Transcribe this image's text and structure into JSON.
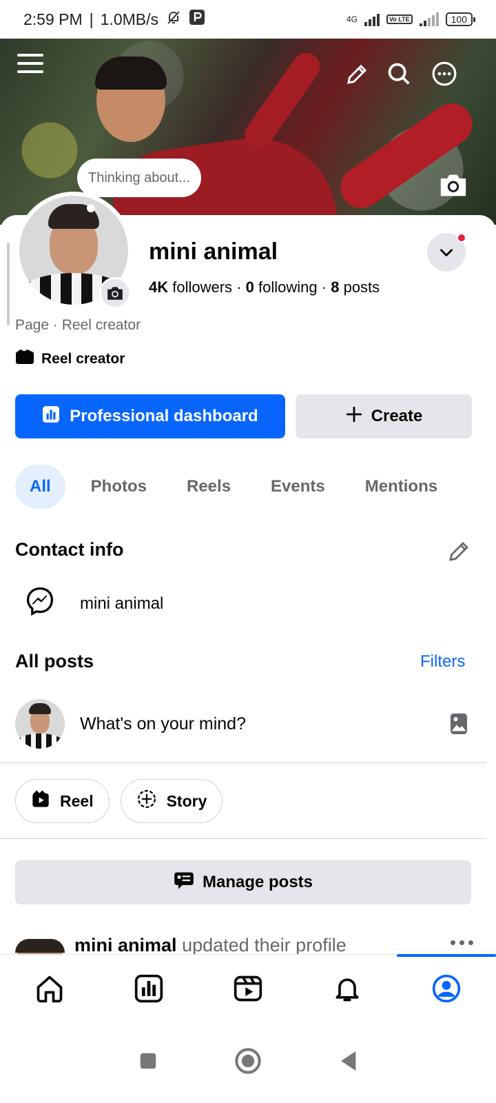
{
  "status_bar": {
    "time": "2:59 PM",
    "separator": "|",
    "speed": "1.0MB/s",
    "network_label": "4G",
    "volte_label": "Vo LTE",
    "battery": "100"
  },
  "cover": {
    "thought_bubble": "Thinking about..."
  },
  "profile": {
    "name": "mini animal",
    "followers_count": "4K",
    "followers_label": "followers",
    "following_count": "0",
    "following_label": "following",
    "posts_count": "8",
    "posts_label": "posts",
    "dot": "·",
    "category": "Page · Reel creator",
    "badge_label": "Reel creator"
  },
  "actions": {
    "dashboard_label": "Professional dashboard",
    "create_label": "Create"
  },
  "tabs": [
    {
      "label": "All",
      "active": true
    },
    {
      "label": "Photos",
      "active": false
    },
    {
      "label": "Reels",
      "active": false
    },
    {
      "label": "Events",
      "active": false
    },
    {
      "label": "Mentions",
      "active": false
    }
  ],
  "contact": {
    "title": "Contact info",
    "messenger_name": "mini animal"
  },
  "posts": {
    "title": "All posts",
    "filters_label": "Filters",
    "composer_placeholder": "What's on your mind?",
    "reel_chip": "Reel",
    "story_chip": "Story",
    "manage_label": "Manage posts",
    "feed_author": "mini animal",
    "feed_action": "updated their profile"
  },
  "colors": {
    "accent": "#0866ff",
    "secondary_bg": "#e4e6eb",
    "notification_dot": "#e41e3f"
  },
  "icons": [
    "menu-icon",
    "pencil-icon",
    "search-icon",
    "more-icon",
    "camera-icon",
    "chevron-down-icon",
    "clapperboard-icon",
    "dashboard-icon",
    "plus-icon",
    "messenger-icon",
    "photo-icon",
    "reel-icon",
    "story-add-icon",
    "manage-posts-icon",
    "home-icon",
    "dashboard-nav-icon",
    "video-icon",
    "bell-icon",
    "profile-icon"
  ]
}
